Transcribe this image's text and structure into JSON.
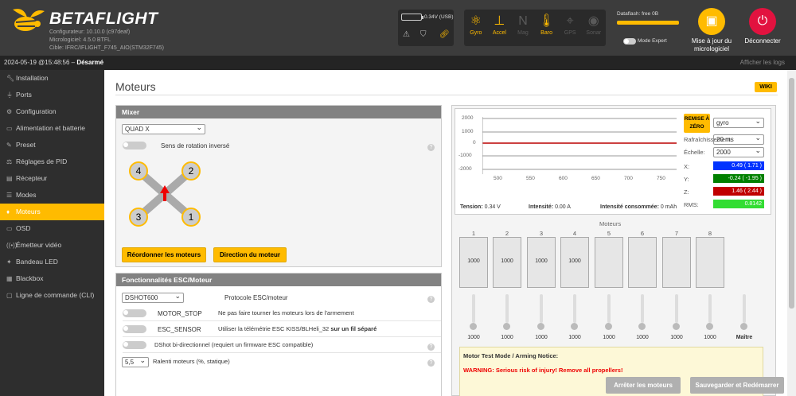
{
  "header": {
    "brand": "BETAFLIGHT",
    "configurator": "Configurateur: 10.10.0 (c97deaf)",
    "firmware": "Micrologiciel: 4.5.0 BTFL",
    "target": "Cible: IFRC/IFLIGHT_F745_AIO(STM32F745)",
    "battery_voltage": "0.34V (USB)",
    "sensors": [
      {
        "label": "Gyro",
        "icon": "gyro-icon",
        "active": true
      },
      {
        "label": "Accel",
        "icon": "accel-icon",
        "active": true
      },
      {
        "label": "Mag",
        "icon": "mag-icon",
        "active": false
      },
      {
        "label": "Baro",
        "icon": "baro-icon",
        "active": true
      },
      {
        "label": "GPS",
        "icon": "gps-icon",
        "active": false
      },
      {
        "label": "Sonar",
        "icon": "sonar-icon",
        "active": false
      }
    ],
    "dataflash": "Dataflash: free 0B",
    "expert_mode": "Mode Expert",
    "flash_button": "Mise à jour du micrologiciel",
    "disconnect_button": "Déconnecter",
    "colors": {
      "accent": "#ffbb00",
      "disconnect": "#e2123f",
      "bar": "#3c3c3c"
    }
  },
  "logbar": {
    "datetime": "2024-05-19 @15:48:56 – ",
    "status": "Désarmé",
    "show_logs": "Afficher les logs"
  },
  "sidebar": {
    "items": [
      {
        "label": "Installation",
        "icon": "wrench-icon"
      },
      {
        "label": "Ports",
        "icon": "plug-icon"
      },
      {
        "label": "Configuration",
        "icon": "gear-icon"
      },
      {
        "label": "Alimentation et batterie",
        "icon": "battery-icon"
      },
      {
        "label": "Preset",
        "icon": "preset-icon"
      },
      {
        "label": "Réglages de PID",
        "icon": "pid-icon"
      },
      {
        "label": "Récepteur",
        "icon": "receiver-icon"
      },
      {
        "label": "Modes",
        "icon": "modes-icon"
      },
      {
        "label": "Moteurs",
        "icon": "motor-icon"
      },
      {
        "label": "OSD",
        "icon": "osd-icon"
      },
      {
        "label": "Émetteur vidéo",
        "icon": "vtx-icon"
      },
      {
        "label": "Bandeau LED",
        "icon": "led-icon"
      },
      {
        "label": "Blackbox",
        "icon": "blackbox-icon"
      },
      {
        "label": "Ligne de commande (CLI)",
        "icon": "cli-icon"
      }
    ],
    "active_index": 8
  },
  "page": {
    "title": "Moteurs",
    "wiki": "WIKI"
  },
  "mixer": {
    "header": "Mixer",
    "type": "QUAD X",
    "reverse_label": "Sens de rotation inversé",
    "motor_labels": [
      "4",
      "2",
      "3",
      "1"
    ],
    "reorder_button": "Réordonner les moteurs",
    "direction_button": "Direction du moteur"
  },
  "esc": {
    "header": "Fonctionnalités ESC/Moteur",
    "protocol": "DSHOT600",
    "protocol_label": "Protocole ESC/moteur",
    "motor_stop": "MOTOR_STOP",
    "motor_stop_desc": "Ne pas faire tourner les moteurs lors de l'armement",
    "esc_sensor": "ESC_SENSOR",
    "esc_sensor_desc": "Utiliser la télémétrie ESC KISS/BLHeli_32 ",
    "esc_sensor_bold": "sur un fil séparé",
    "bidir": "DShot bi-directionnel (requiert un firmware ESC compatible)",
    "idle_value": "5,5",
    "idle_label": "Ralenti moteurs (%, statique)"
  },
  "graph": {
    "y_ticks": [
      "2000",
      "1000",
      "0",
      "-1000",
      "-2000"
    ],
    "x_ticks": [
      "500",
      "550",
      "600",
      "650",
      "700",
      "750"
    ],
    "reset_button": "REMISE À ZÉRO",
    "sensor_select": "gyro",
    "refresh_label": "Rafraîchissement:",
    "refresh_value": "20 ms",
    "scale_label": "Échelle:",
    "scale_value": "2000",
    "readouts": [
      {
        "axis": "X:",
        "value": "0.49 ( 1.71 )",
        "color": "#0033ff"
      },
      {
        "axis": "Y:",
        "value": "-0.24 ( -1.95 )",
        "color": "#008000"
      },
      {
        "axis": "Z:",
        "value": "1.46 ( 2.44 )",
        "color": "#c00000"
      },
      {
        "axis": "RMS:",
        "value": "0.8142",
        "color": "#33dd33"
      }
    ],
    "tension_label": "Tension:",
    "tension_value": "0.34 V",
    "intensity_label": "Intensité:",
    "intensity_value": "0.00 A",
    "consumed_label": "Intensité consommée:",
    "consumed_value": "0 mAh"
  },
  "motors": {
    "title": "Moteurs",
    "numbers": [
      "1",
      "2",
      "3",
      "4",
      "5",
      "6",
      "7",
      "8"
    ],
    "bar_values": [
      "1000",
      "1000",
      "1000",
      "1000",
      "",
      "",
      "",
      ""
    ],
    "slider_values": [
      "1000",
      "1000",
      "1000",
      "1000",
      "1000",
      "1000",
      "1000",
      "1000"
    ],
    "master_label": "Maître"
  },
  "notice": {
    "title": "Motor Test Mode / Arming Notice:",
    "warning": "WARNING: Serious risk of injury! Remove all propellers!"
  },
  "footer": {
    "stop_button": "Arrêter les moteurs",
    "save_button": "Sauvegarder et Redémarrer"
  }
}
